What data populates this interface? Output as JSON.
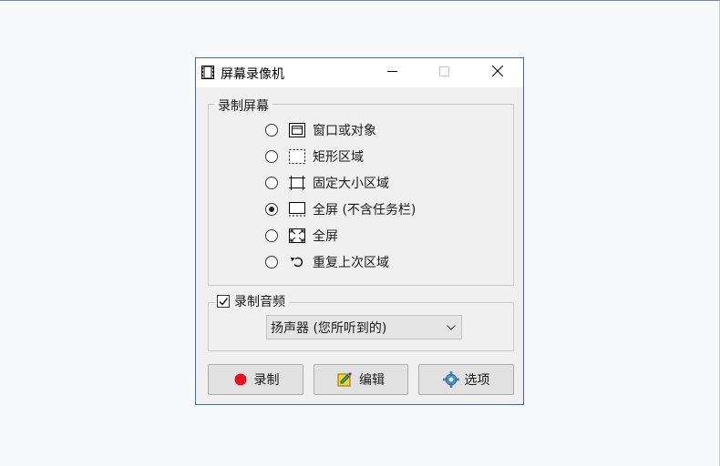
{
  "window": {
    "title": "屏幕录像机",
    "icon": "film-icon",
    "controls": {
      "minimize": "minimize-icon",
      "maximize": "maximize-icon",
      "close": "close-icon"
    }
  },
  "record_screen": {
    "label": "录制屏幕",
    "options": [
      {
        "label": "窗口或对象",
        "icon": "window-object-icon",
        "selected": false
      },
      {
        "label": "矩形区域",
        "icon": "rectangle-region-icon",
        "selected": false
      },
      {
        "label": "固定大小区域",
        "icon": "fixed-size-region-icon",
        "selected": false
      },
      {
        "label": "全屏 (不含任务栏)",
        "icon": "fullscreen-no-taskbar-icon",
        "selected": true
      },
      {
        "label": "全屏",
        "icon": "fullscreen-icon",
        "selected": false
      },
      {
        "label": "重复上次区域",
        "icon": "repeat-last-region-icon",
        "selected": false
      }
    ]
  },
  "record_audio": {
    "label": "录制音频",
    "checked": true,
    "source_selected": "扬声器 (您所听到的)"
  },
  "buttons": {
    "record": {
      "label": "录制",
      "icon": "record-icon",
      "color": "#e81123"
    },
    "edit": {
      "label": "编辑",
      "icon": "edit-icon"
    },
    "options": {
      "label": "选项",
      "icon": "gear-icon"
    }
  }
}
